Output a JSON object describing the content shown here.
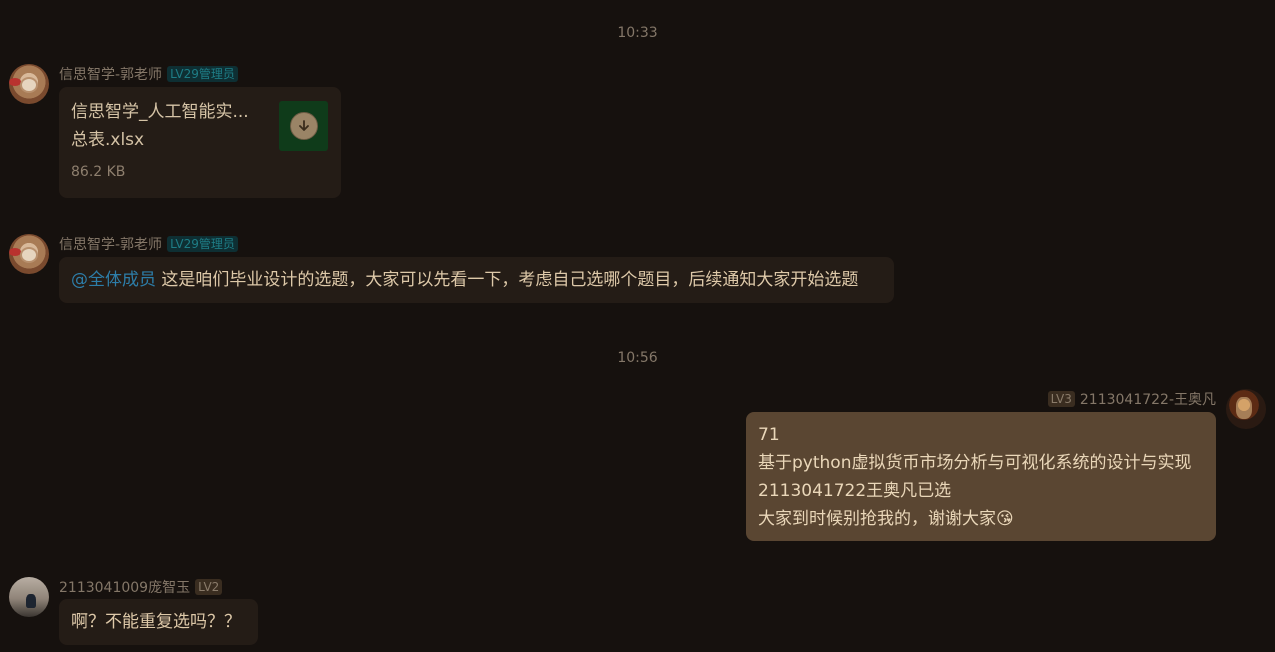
{
  "timestamps": [
    "10:33",
    "10:56"
  ],
  "messages": [
    {
      "sender": "信思智学-郭老师",
      "badge": "LV29管理员",
      "file": {
        "name_line1": "信思智学_人工智能实...",
        "name_line2": "总表.xlsx",
        "size": "86.2 KB",
        "icon": "download-icon"
      }
    },
    {
      "sender": "信思智学-郭老师",
      "badge": "LV29管理员",
      "mention": "@全体成员",
      "text": " 这是咱们毕业设计的选题，大家可以先看一下，考虑自己选哪个题目，后续通知大家开始选题"
    },
    {
      "sender": "2113041722-王奥凡",
      "badge": "LV3",
      "lines": [
        "71",
        "基于python虚拟货币市场分析与可视化系统的设计与实现",
        "2113041722王奥凡已选",
        "大家到时候别抢我的，谢谢大家"
      ],
      "emoji": "😘"
    },
    {
      "sender": "2113041009庞智玉",
      "badge": "LV2",
      "text": "啊？不能重复选吗？？"
    }
  ],
  "colors": {
    "background": "#16110e",
    "bubble_other": "#241c16",
    "bubble_me": "#5a4632",
    "mention": "#2d7da8",
    "admin_badge": "#1e7d86"
  }
}
